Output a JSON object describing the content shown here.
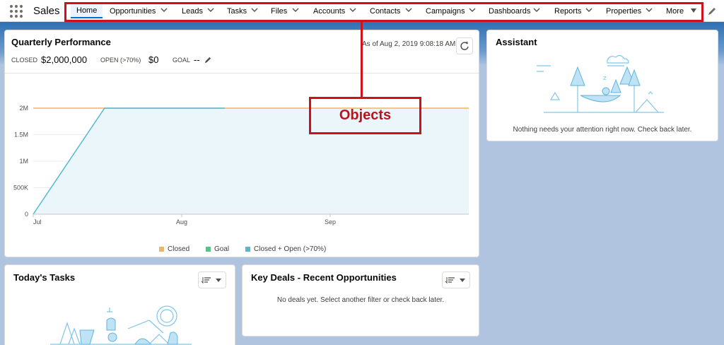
{
  "app": {
    "name": "Sales"
  },
  "nav": {
    "items": [
      {
        "label": "Home",
        "active": true
      },
      {
        "label": "Opportunities"
      },
      {
        "label": "Leads"
      },
      {
        "label": "Tasks"
      },
      {
        "label": "Files"
      },
      {
        "label": "Accounts"
      },
      {
        "label": "Contacts"
      },
      {
        "label": "Campaigns"
      },
      {
        "label": "Dashboards"
      },
      {
        "label": "Reports"
      },
      {
        "label": "Properties"
      },
      {
        "label": "More"
      }
    ]
  },
  "annotation": {
    "label": "Objects",
    "color": "#d0111b"
  },
  "quarterly": {
    "title": "Quarterly Performance",
    "as_of": "As of Aug 2, 2019 9:08:18 AM",
    "closed_label": "CLOSED",
    "closed_value": "$2,000,000",
    "open_label": "OPEN (>70%)",
    "open_value": "$0",
    "goal_label": "GOAL",
    "goal_value": "--"
  },
  "chart_data": {
    "type": "area",
    "x_categories": [
      "Jul",
      "Aug",
      "Sep"
    ],
    "y_ticks": [
      "0",
      "500K",
      "1M",
      "1.5M",
      "2M"
    ],
    "ylim": [
      0,
      2000000
    ],
    "series": [
      {
        "name": "Closed",
        "color": "#f4b35f",
        "points": [
          [
            0,
            2000000
          ],
          [
            1.29,
            2000000
          ]
        ]
      },
      {
        "name": "Goal",
        "color": "#4bca81",
        "points": []
      },
      {
        "name": "Closed + Open (>70%)",
        "color": "#54b7d3",
        "points": [
          [
            0,
            0
          ],
          [
            0.48,
            2000000
          ],
          [
            1.29,
            2000000
          ]
        ]
      }
    ],
    "legend": [
      "Closed",
      "Goal",
      "Closed + Open (>70%)"
    ]
  },
  "assistant": {
    "title": "Assistant",
    "message": "Nothing needs your attention right now. Check back later."
  },
  "tasks": {
    "title": "Today's Tasks"
  },
  "key_deals": {
    "title": "Key Deals - Recent Opportunities",
    "message": "No deals yet. Select another filter or check back later."
  }
}
